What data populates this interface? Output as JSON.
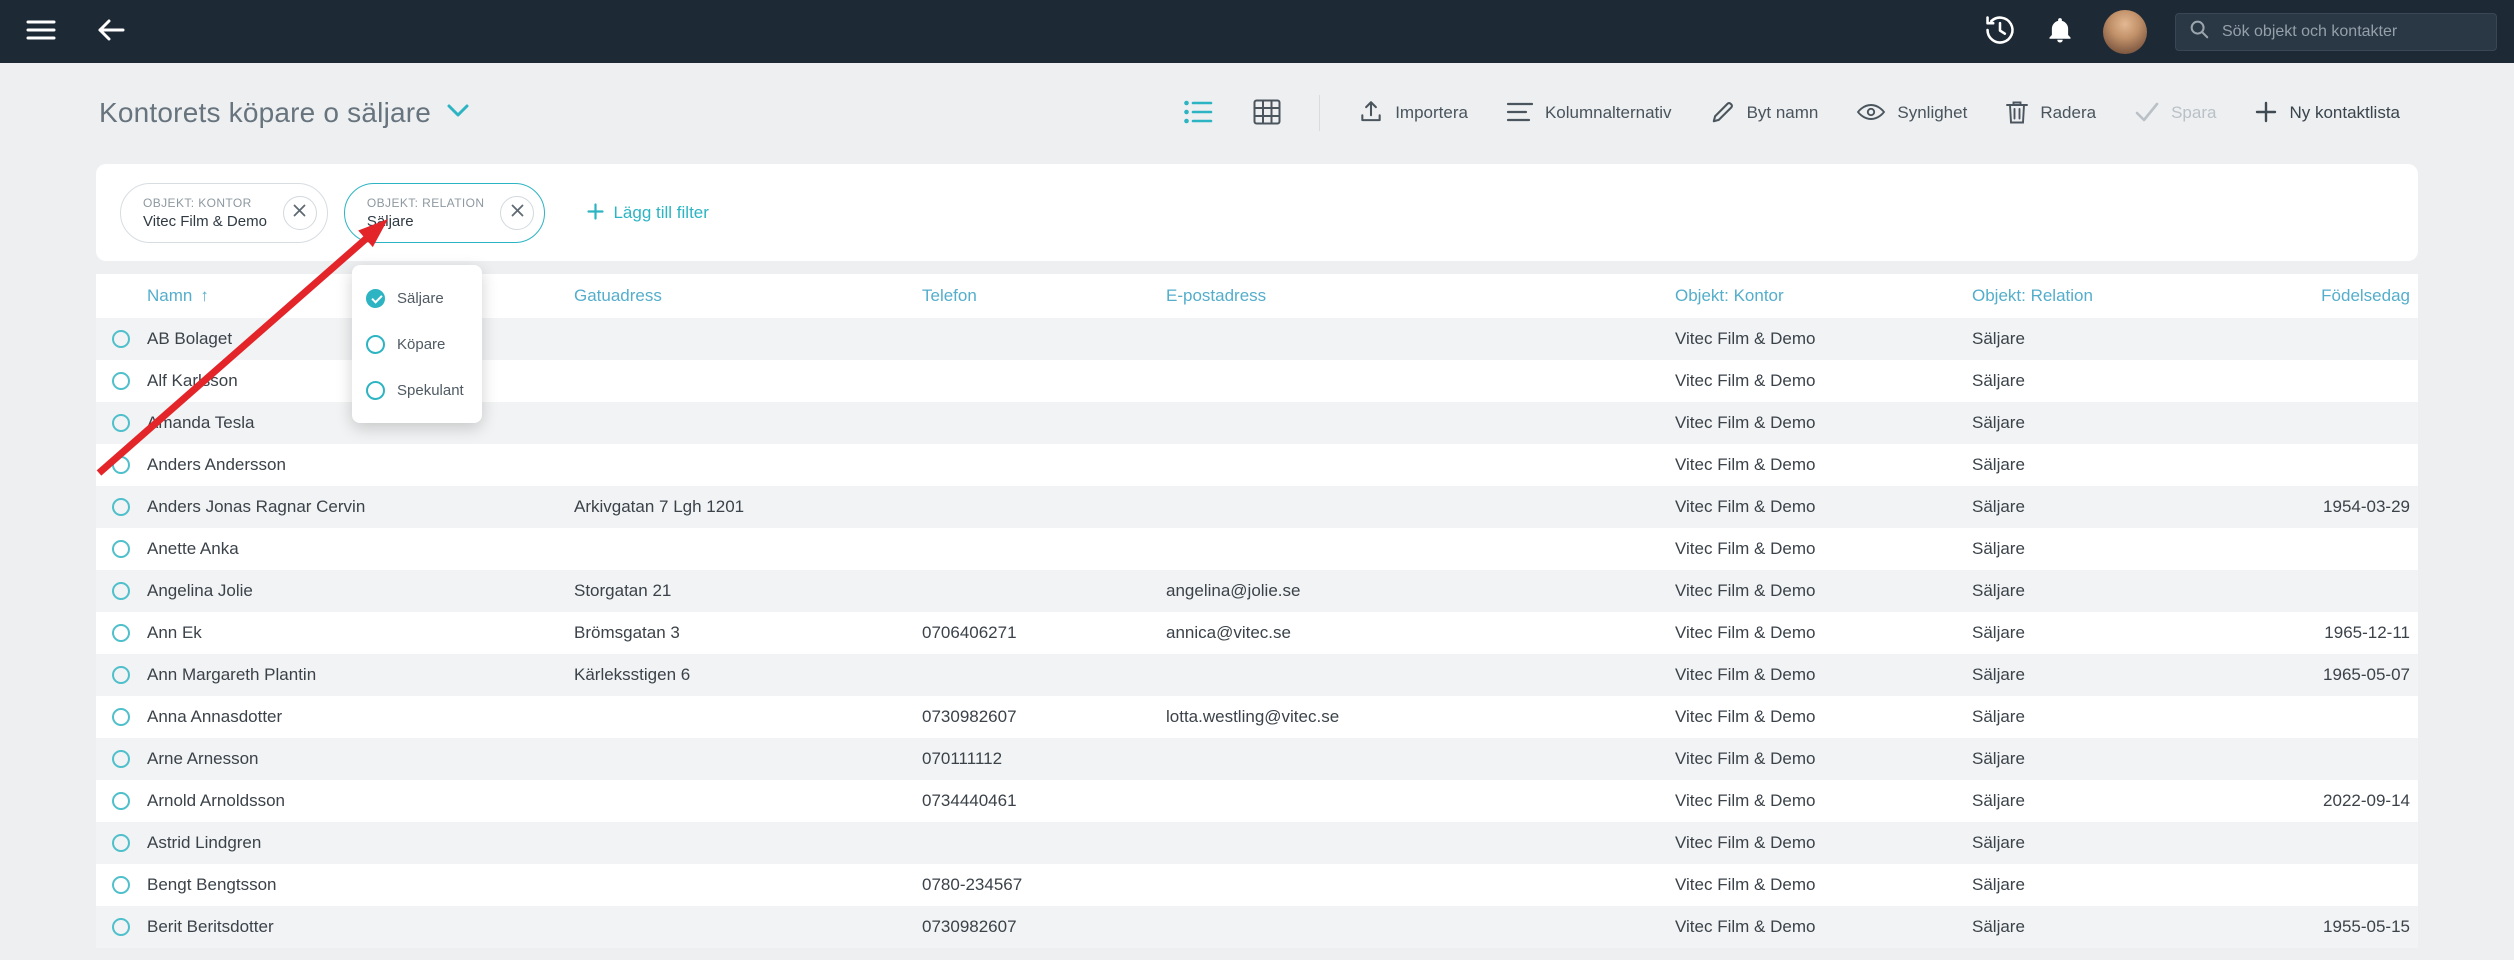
{
  "topbar": {
    "search_placeholder": "Sök objekt och kontakter"
  },
  "header": {
    "title": "Kontorets köpare o säljare"
  },
  "toolbar": {
    "importera": "Importera",
    "kolumnalternativ": "Kolumnalternativ",
    "byt_namn": "Byt namn",
    "synlighet": "Synlighet",
    "radera": "Radera",
    "spara": "Spara",
    "ny_kontaktlista": "Ny kontaktlista"
  },
  "filters": {
    "chips": [
      {
        "label": "OBJEKT: KONTOR",
        "value": "Vitec Film & Demo",
        "active": false
      },
      {
        "label": "OBJEKT: RELATION",
        "value": "Säljare",
        "active": true
      }
    ],
    "add_label": "Lägg till filter",
    "options": [
      {
        "label": "Säljare",
        "selected": true
      },
      {
        "label": "Köpare",
        "selected": false
      },
      {
        "label": "Spekulant",
        "selected": false
      }
    ]
  },
  "table": {
    "columns": [
      "Namn",
      "Gatuadress",
      "Telefon",
      "E-postadress",
      "Objekt: Kontor",
      "Objekt: Relation",
      "Födelsedag"
    ],
    "sort": {
      "column": "Namn",
      "direction": "asc",
      "arrow": "↑"
    },
    "rows": [
      {
        "namn": "AB Bolaget",
        "gatuadress": "",
        "telefon": "",
        "epost": "",
        "kontor": "Vitec Film & Demo",
        "relation": "Säljare",
        "fodelsedag": ""
      },
      {
        "namn": "Alf Karlsson",
        "gatuadress": "",
        "telefon": "",
        "epost": "",
        "kontor": "Vitec Film & Demo",
        "relation": "Säljare",
        "fodelsedag": ""
      },
      {
        "namn": "Amanda Tesla",
        "gatuadress": "",
        "telefon": "",
        "epost": "",
        "kontor": "Vitec Film & Demo",
        "relation": "Säljare",
        "fodelsedag": ""
      },
      {
        "namn": "Anders Andersson",
        "gatuadress": "",
        "telefon": "",
        "epost": "",
        "kontor": "Vitec Film & Demo",
        "relation": "Säljare",
        "fodelsedag": ""
      },
      {
        "namn": "Anders Jonas Ragnar Cervin",
        "gatuadress": "Arkivgatan 7 Lgh 1201",
        "telefon": "",
        "epost": "",
        "kontor": "Vitec Film & Demo",
        "relation": "Säljare",
        "fodelsedag": "1954-03-29"
      },
      {
        "namn": "Anette Anka",
        "gatuadress": "",
        "telefon": "",
        "epost": "",
        "kontor": "Vitec Film & Demo",
        "relation": "Säljare",
        "fodelsedag": ""
      },
      {
        "namn": "Angelina Jolie",
        "gatuadress": "Storgatan 21",
        "telefon": "",
        "epost": "angelina@jolie.se",
        "kontor": "Vitec Film & Demo",
        "relation": "Säljare",
        "fodelsedag": ""
      },
      {
        "namn": "Ann Ek",
        "gatuadress": "Brömsgatan 3",
        "telefon": "0706406271",
        "epost": "annica@vitec.se",
        "kontor": "Vitec Film & Demo",
        "relation": "Säljare",
        "fodelsedag": "1965-12-11"
      },
      {
        "namn": "Ann Margareth Plantin",
        "gatuadress": "Kärleksstigen 6",
        "telefon": "",
        "epost": "",
        "kontor": "Vitec Film & Demo",
        "relation": "Säljare",
        "fodelsedag": "1965-05-07"
      },
      {
        "namn": "Anna Annasdotter",
        "gatuadress": "",
        "telefon": "0730982607",
        "epost": "lotta.westling@vitec.se",
        "kontor": "Vitec Film & Demo",
        "relation": "Säljare",
        "fodelsedag": ""
      },
      {
        "namn": "Arne Arnesson",
        "gatuadress": "",
        "telefon": "070111112",
        "epost": "",
        "kontor": "Vitec Film & Demo",
        "relation": "Säljare",
        "fodelsedag": ""
      },
      {
        "namn": "Arnold Arnoldsson",
        "gatuadress": "",
        "telefon": "0734440461",
        "epost": "",
        "kontor": "Vitec Film & Demo",
        "relation": "Säljare",
        "fodelsedag": "2022-09-14"
      },
      {
        "namn": "Astrid Lindgren",
        "gatuadress": "",
        "telefon": "",
        "epost": "",
        "kontor": "Vitec Film & Demo",
        "relation": "Säljare",
        "fodelsedag": ""
      },
      {
        "namn": "Bengt Bengtsson",
        "gatuadress": "",
        "telefon": "0780-234567",
        "epost": "",
        "kontor": "Vitec Film & Demo",
        "relation": "Säljare",
        "fodelsedag": ""
      },
      {
        "namn": "Berit Beritsdotter",
        "gatuadress": "",
        "telefon": "0730982607",
        "epost": "",
        "kontor": "Vitec Film & Demo",
        "relation": "Säljare",
        "fodelsedag": "1955-05-15"
      }
    ]
  },
  "colors": {
    "accent_teal": "#2cb4c3",
    "topbar_bg": "#1d2935",
    "column_header_text": "#54aecb",
    "annotation_red": "#e32428",
    "row_stripe": "#f1f3f4"
  }
}
